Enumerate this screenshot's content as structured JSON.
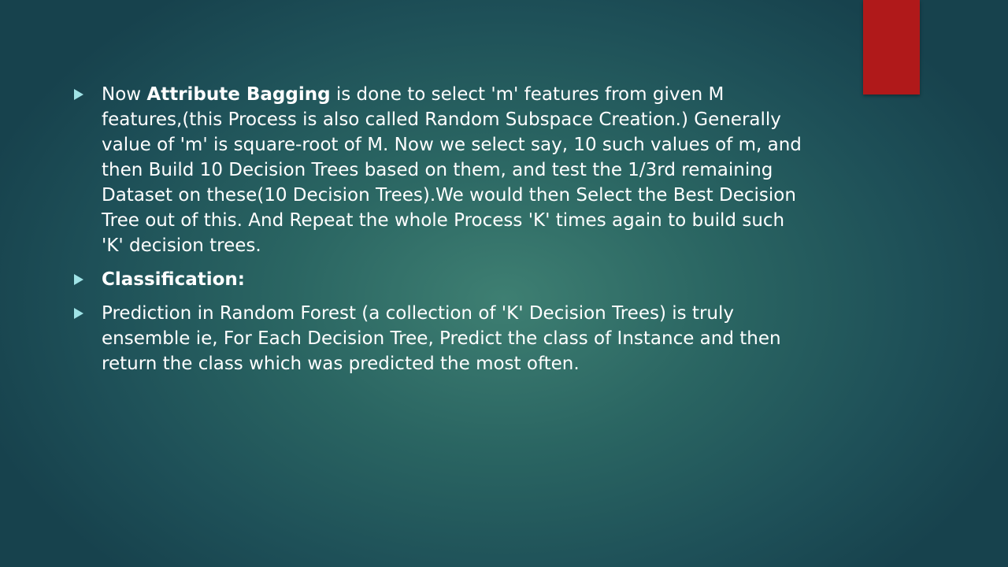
{
  "slide": {
    "bullets": [
      {
        "pre": "Now ",
        "bold": "Attribute Bagging",
        "post": " is done to select 'm' features from given M features,(this Process is also called Random Subspace Creation.) Generally value of 'm' is square-root of M. Now we select say, 10 such values of m, and then Build 10 Decision Trees based on them, and test the 1/3rd remaining Dataset on these(10 Decision Trees).We would then Select the Best Decision Tree out of this. And Repeat the whole Process 'K' times again to build such 'K' decision trees."
      },
      {
        "bold": "Classification:"
      },
      {
        "text": "Prediction in Random Forest (a collection of 'K' Decision Trees) is truly ensemble ie, For Each Decision Tree, Predict the class of Instance and then return the class which was predicted the most often."
      }
    ],
    "colors": {
      "accent_bar": "#b0191a",
      "bullet_marker": "#9fe3e6",
      "text": "#ffffff",
      "background": "#2a6562"
    },
    "icons": {
      "bullet": "triangle-right-icon"
    }
  }
}
